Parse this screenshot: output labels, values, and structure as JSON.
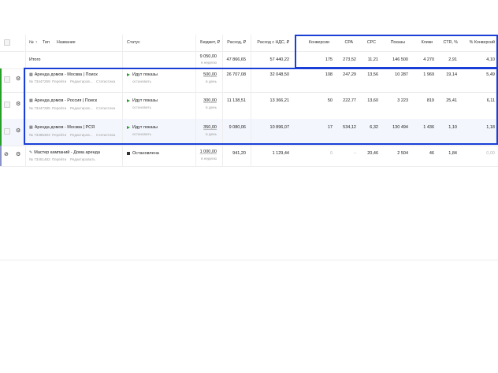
{
  "header": {
    "num_label": "№",
    "sort_arrow": "↑",
    "type_label": "Тип",
    "name_label": "Название",
    "status_label": "Статус",
    "budget_label": "Бюджет, ₽",
    "spend_label": "Расход, ₽",
    "spend_vat_label": "Расход с НДС, ₽",
    "conversions_label": "Конверсии",
    "cpa_label": "CPA",
    "cpc_label": "CPC",
    "impressions_label": "Показы",
    "clicks_label": "Клики",
    "ctr_label": "CTR, %",
    "conv_rate_label": "% Конверсий"
  },
  "total": {
    "label": "Итого",
    "budget": "9 050,00",
    "budget_period": "в неделю",
    "spend": "47 866,65",
    "spend_vat": "57 440,22",
    "conversions": "175",
    "cpa": "273,52",
    "cpc": "11,21",
    "impressions": "146 500",
    "clicks": "4 270",
    "ctr": "2,91",
    "conv_rate": "4,10"
  },
  "campaigns": [
    {
      "name": "Аренда домов - Москва | Поиск",
      "id": "№ 73447259",
      "actions": [
        "Перейти",
        "Редактиров...",
        "Статистика"
      ],
      "status": "Идут показы",
      "status_action": "остановить",
      "budget": "500,00",
      "budget_period": "в день",
      "spend": "26 707,08",
      "spend_vat": "32 048,50",
      "conversions": "108",
      "cpa": "247,29",
      "cpc": "13,56",
      "impressions": "10 287",
      "clicks": "1 969",
      "ctr": "19,14",
      "conv_rate": "5,49"
    },
    {
      "name": "Аренда домов - Россия | Поиск",
      "id": "№ 73447295",
      "actions": [
        "Перейти",
        "Редактиров...",
        "Статистика"
      ],
      "status": "Идут показы",
      "status_action": "остановить",
      "budget": "300,00",
      "budget_period": "в день",
      "spend": "11 138,51",
      "spend_vat": "13 366,21",
      "conversions": "50",
      "cpa": "222,77",
      "cpc": "13,60",
      "impressions": "3 223",
      "clicks": "819",
      "ctr": "25,41",
      "conv_rate": "6,11"
    },
    {
      "name": "Аренда домов - Москва | РСЯ",
      "id": "№ 73485303",
      "actions": [
        "Перейти",
        "Редактиров...",
        "Статистика"
      ],
      "status": "Идут показы",
      "status_action": "остановить",
      "budget": "350,00",
      "budget_period": "в день",
      "spend": "9 080,06",
      "spend_vat": "10 896,07",
      "conversions": "17",
      "cpa": "534,12",
      "cpc": "6,32",
      "impressions": "130 494",
      "clicks": "1 436",
      "ctr": "1,10",
      "conv_rate": "1,18"
    },
    {
      "name": "Мастер кампаний - Дома аренда",
      "id": "№ 73451482",
      "actions": [
        "Перейти",
        "Редактировать"
      ],
      "status": "Остановлена",
      "budget": "1 000,00",
      "budget_period": "в неделю",
      "spend": "941,20",
      "spend_vat": "1 129,44",
      "conversions": "0",
      "cpa": "–",
      "cpc": "20,46",
      "impressions": "2 504",
      "clicks": "46",
      "ctr": "1,84",
      "conv_rate": "0,00"
    }
  ],
  "colors": {
    "highlight": "#1a3fd6",
    "active": "#27a027"
  }
}
